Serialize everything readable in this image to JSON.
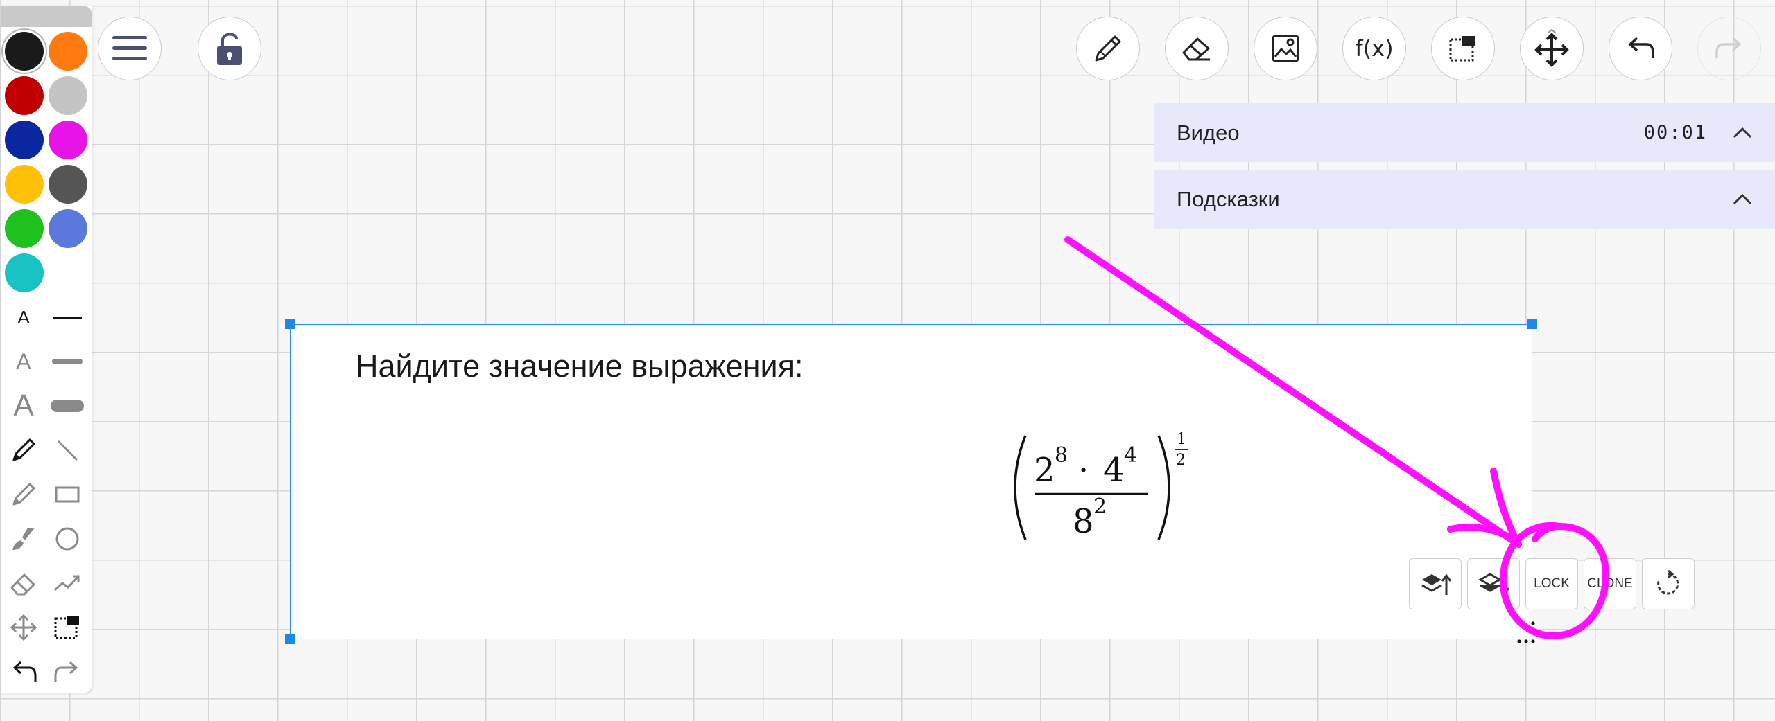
{
  "palette": {
    "colors": [
      "#1a1a1a",
      "#ff7a0f",
      "#c00000",
      "#c4c4c4",
      "#0a27a0",
      "#e713e7",
      "#ffc107",
      "#555555",
      "#1ec11e",
      "#5b78dc",
      "#19c3c3"
    ],
    "selected_color": "#1a1a1a",
    "text_size_small": "A",
    "text_size_medium": "A",
    "text_size_large": "A",
    "tools": [
      "text-size-small",
      "line-thin",
      "text-size-medium",
      "line-medium",
      "text-size-large",
      "line-thick",
      "pen",
      "line",
      "highlighter",
      "rectangle",
      "brush",
      "ellipse",
      "eraser",
      "polyline",
      "move",
      "select",
      "undo",
      "redo"
    ]
  },
  "toolbar": {
    "function_label": "f(x)",
    "icons": [
      "menu-icon",
      "unlock-icon",
      "pencil-icon",
      "eraser-icon",
      "image-icon",
      "function-icon",
      "select-area-icon",
      "move-icon",
      "undo-icon",
      "redo-icon"
    ]
  },
  "panels": {
    "video": {
      "title": "Видео",
      "time": "00:01"
    },
    "hints": {
      "title": "Подсказки"
    }
  },
  "task": {
    "prompt": "Найдите значение выражения:",
    "formula": {
      "base_a": "2",
      "exp_a": "8",
      "dot": "·",
      "base_b": "4",
      "exp_b": "4",
      "base_c": "8",
      "exp_c": "2",
      "outer_num": "1",
      "outer_den": "2"
    }
  },
  "object_toolbar": {
    "lock_label": "LOCK",
    "clone_label": "CLONE",
    "icons": [
      "bring-forward-icon",
      "send-backward-icon",
      "rotate-icon"
    ]
  },
  "annotation": {
    "color": "#ff10ff"
  }
}
